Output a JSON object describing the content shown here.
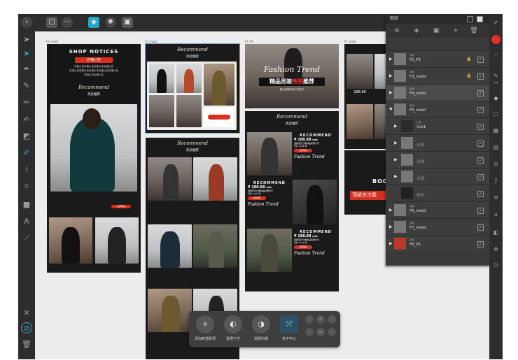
{
  "topbar": {
    "back_icon": "back-arrow-icon",
    "buttons": [
      "document-icon",
      "more-icon",
      "persona-icon",
      "grid-icon",
      "export-icon"
    ]
  },
  "left_tools": [
    "move-icon",
    "node-icon",
    "pen-icon",
    "brush-icon",
    "pencil-icon",
    "paint-icon",
    "eraser-icon",
    "fill-icon",
    "picker-icon",
    "crop-icon",
    "shape-icon",
    "text-icon",
    "eyedropper-icon",
    "close-icon",
    "settings-icon",
    "trash-icon"
  ],
  "canvas": {
    "artboards": [
      {
        "label": "F4_mixG"
      },
      {
        "label": "F3_mixG"
      },
      {
        "label": "F2_P1"
      },
      {
        "label": "F7_mixG"
      },
      {
        "label": "F5_mixG"
      },
      {
        "label": "F1_P1"
      },
      {
        "label": "F6_P1"
      }
    ],
    "shop_notices": {
      "title": "SHOP NOTICES",
      "badge": "店铺公告",
      "lines": [
        "店铺公告店铺公告店铺公告店铺公告",
        "店铺公告店铺公告店铺公告店铺公告店铺公告",
        "店铺公告店铺公告"
      ],
      "script": "Recommend",
      "cn": "热卖推荐",
      "cta": "立即购买"
    },
    "recommend": {
      "script": "Recommend",
      "cn": "热卖推荐"
    },
    "fashion": {
      "script": "Fashion Trend",
      "cn_title_1": "精品男装",
      "cn_title_2": "畅销",
      "cn_title_3": "推荐",
      "sub": "显示品牌名称介绍文字"
    },
    "rec_blocks": [
      {
        "title": "RECOMMEND",
        "price": "¥ 188.88",
        "unit": "RMB",
        "desc": "选择宝贝分类商品标题文字",
        "sold": "已售 1234 件",
        "btn": "立即购买",
        "script": "Fashion Trend"
      },
      {
        "title": "RECOMMEND",
        "price": "¥ 188.88",
        "unit": "RMB",
        "desc": "选择宝贝分类商品标题文字",
        "sold": "已售 1234 件",
        "btn": "立即购买",
        "script": "Fashion Trend"
      },
      {
        "title": "RECOMMEND",
        "price": "¥ 188.88",
        "unit": "RMB",
        "desc": "选择宝贝分类商品标题文字",
        "sold": "已售 1234 件",
        "btn": "立即购买",
        "script": "Fashion Trend"
      }
    ],
    "small_price": "188.88",
    "right_partial": {
      "title": "BOO",
      "banner": "顶部关注我"
    }
  },
  "layers_panel": {
    "title": "图层",
    "header_icons": [
      "list-icon",
      "brush-icon"
    ],
    "tool_icons": [
      "minus-circle-icon",
      "layers-icon",
      "mask-icon",
      "add-icon",
      "delete-icon"
    ],
    "layers": [
      {
        "tag": "画板",
        "name": "F2_P1",
        "locked": true,
        "expanded": false
      },
      {
        "tag": "画板",
        "name": "F3_mixG",
        "locked": true,
        "expanded": false
      },
      {
        "tag": "画板",
        "name": "F4_mixG",
        "locked": false,
        "expanded": false
      },
      {
        "tag": "画板",
        "name": "F5_mixG",
        "locked": false,
        "expanded": true
      },
      {
        "tag": "分组",
        "name": "link1",
        "locked": false,
        "expanded": false
      },
      {
        "tag": "",
        "name": "分组",
        "locked": false,
        "expanded": false
      },
      {
        "tag": "",
        "name": "分组",
        "locked": false,
        "expanded": false
      },
      {
        "tag": "",
        "name": "分组",
        "locked": false,
        "expanded": false
      },
      {
        "tag": "",
        "name": "矩形",
        "locked": false,
        "expanded": false
      },
      {
        "tag": "画板",
        "name": "F6_mixG",
        "locked": false,
        "expanded": false
      },
      {
        "tag": "画板",
        "name": "F7_mixG",
        "locked": false,
        "expanded": false
      },
      {
        "tag": "画板",
        "name": "F8_P1",
        "locked": false,
        "expanded": false
      }
    ]
  },
  "right_tools": [
    {
      "icon": "pen-nib-icon",
      "label": ""
    },
    {
      "icon": "color-circle-icon",
      "label": ""
    },
    {
      "icon": "stroke-icon",
      "label": ""
    },
    {
      "icon": "brush-icon",
      "label": "画笔"
    },
    {
      "icon": "layers-icon",
      "label": ""
    },
    {
      "icon": "effects-icon",
      "label": ""
    },
    {
      "icon": "grid-icon",
      "label": ""
    },
    {
      "icon": "image-icon",
      "label": ""
    },
    {
      "icon": "navigator-icon",
      "label": ""
    },
    {
      "icon": "fx-icon",
      "label": ""
    },
    {
      "icon": "transform-icon",
      "label": ""
    },
    {
      "icon": "text-style-icon",
      "label": ""
    },
    {
      "icon": "stock-icon",
      "label": ""
    },
    {
      "icon": "constraints-icon",
      "label": ""
    },
    {
      "icon": "history-icon",
      "label": ""
    }
  ],
  "context_bar": {
    "items": [
      {
        "icon": "add-to-selection-icon",
        "label": "添加到选取项"
      },
      {
        "icon": "select-below-icon",
        "label": "选择下方"
      },
      {
        "icon": "select-inside-icon",
        "label": "选择内部"
      },
      {
        "icon": "fit-center-icon",
        "label": "关于中心"
      }
    ],
    "mini_icons": [
      "align-tl-icon",
      "align-tc-icon",
      "align-tr-icon",
      "align-bl-icon",
      "align-bc-icon",
      "align-br-icon"
    ]
  },
  "colors": {
    "accent": "#2aa7c8",
    "brand_red": "#d6301f",
    "panel": "#3a3a3a",
    "chrome": "#2d2d2d"
  }
}
